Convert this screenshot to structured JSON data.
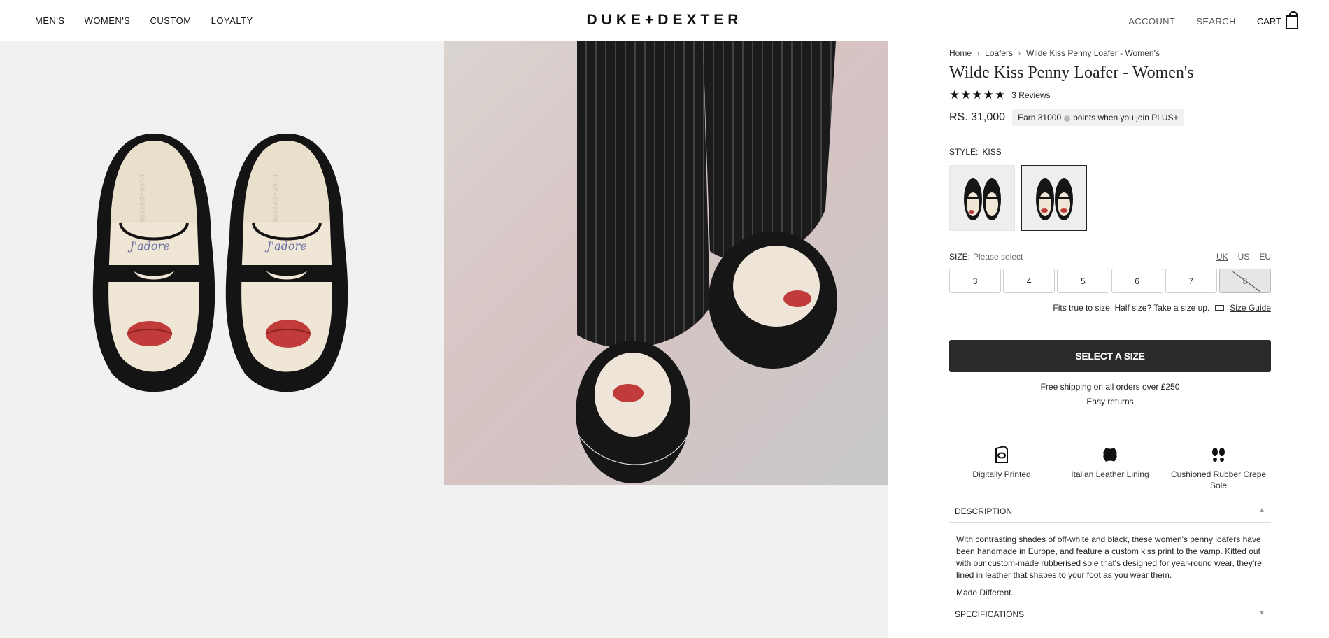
{
  "header": {
    "nav": [
      "MEN'S",
      "WOMEN'S",
      "CUSTOM",
      "LOYALTY"
    ],
    "logo": "DUKE+DEXTER",
    "account": "ACCOUNT",
    "search": "SEARCH",
    "cart": "CART"
  },
  "breadcrumb": [
    "Home",
    "Loafers",
    "Wilde Kiss Penny Loafer - Women's"
  ],
  "product": {
    "title": "Wilde Kiss Penny Loafer - Women's",
    "rating": 5,
    "reviews": "3 Reviews",
    "price": "RS. 31,000",
    "earn_prefix": "Earn 31000",
    "earn_suffix": "points when you join PLUS+"
  },
  "style": {
    "label": "STYLE:",
    "value": "KISS"
  },
  "size": {
    "label": "SIZE:",
    "placeholder": "Please select",
    "units": [
      "UK",
      "US",
      "EU"
    ],
    "options": [
      "3",
      "4",
      "5",
      "6",
      "7",
      "8"
    ],
    "fit_note": "Fits true to size. Half size? Take a size up.",
    "guide": "Size Guide"
  },
  "cta": {
    "label": "SELECT A SIZE"
  },
  "shipping": {
    "line1": "Free shipping on all orders over £250",
    "line2": "Easy returns"
  },
  "features": [
    {
      "icon": "digital-print-icon",
      "label": "Digitally Printed"
    },
    {
      "icon": "leather-icon",
      "label": "Italian Leather Lining"
    },
    {
      "icon": "footprints-icon",
      "label": "Cushioned Rubber Crepe Sole"
    }
  ],
  "description": {
    "heading": "DESCRIPTION",
    "body": "With contrasting shades of off-white and black, these women's penny loafers have been handmade in Europe, and feature a custom kiss print to the vamp. Kitted out with our custom-made rubberised sole that's designed for year-round wear, they're lined in leather that shapes to your foot as you wear them.",
    "tagline": "Made Different."
  },
  "specifications": {
    "heading": "SPECIFICATIONS"
  },
  "images": {
    "shoe_script_text": "J'adore",
    "shoe_brand_text": "DUKE+DEXTER"
  },
  "colors": {
    "accent_dark": "#2a2a2a",
    "kiss_red": "#c23b3b",
    "cream": "#efe6d6"
  }
}
